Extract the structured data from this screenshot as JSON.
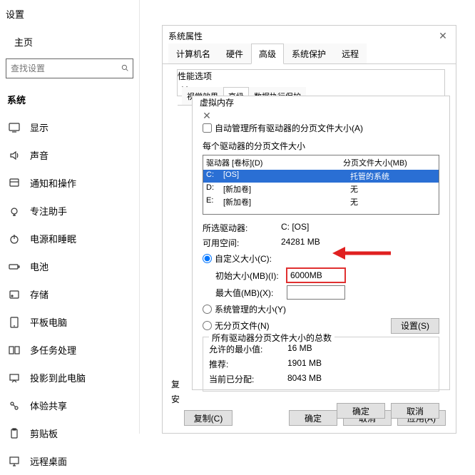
{
  "settings": {
    "title": "设置",
    "home": "主页",
    "search_placeholder": "查找设置",
    "category": "系统",
    "nav": [
      {
        "id": "display",
        "label": "显示"
      },
      {
        "id": "sound",
        "label": "声音"
      },
      {
        "id": "notifications",
        "label": "通知和操作"
      },
      {
        "id": "focus",
        "label": "专注助手"
      },
      {
        "id": "power",
        "label": "电源和睡眠"
      },
      {
        "id": "battery",
        "label": "电池"
      },
      {
        "id": "storage",
        "label": "存储"
      },
      {
        "id": "tablet",
        "label": "平板电脑"
      },
      {
        "id": "multitask",
        "label": "多任务处理"
      },
      {
        "id": "project",
        "label": "投影到此电脑"
      },
      {
        "id": "shared",
        "label": "体验共享"
      },
      {
        "id": "clipboard",
        "label": "剪贴板"
      },
      {
        "id": "remote",
        "label": "远程桌面"
      }
    ]
  },
  "sysprops": {
    "title": "系统属性",
    "tabs": [
      "计算机名",
      "硬件",
      "高级",
      "系统保护",
      "远程"
    ],
    "active_tab": 2,
    "hint1": "复",
    "hint2": "安",
    "copy_btn": "复制(C)",
    "ok": "确定",
    "cancel": "取消",
    "apply": "应用(A)"
  },
  "perfopts": {
    "title": "性能选项",
    "tabs": [
      "视觉效果",
      "高级",
      "数据执行保护"
    ],
    "active_tab": 1
  },
  "vmem": {
    "title": "虚拟内存",
    "auto_manage": "自动管理所有驱动器的分页文件大小(A)",
    "each_drive": "每个驱动器的分页文件大小",
    "col_drive": "驱动器 [卷标](D)",
    "col_pagefile": "分页文件大小(MB)",
    "drives": [
      {
        "letter": "C:",
        "label": "[OS]",
        "size": "托管的系统",
        "selected": true
      },
      {
        "letter": "D:",
        "label": "[新加卷]",
        "size": "无",
        "selected": false
      },
      {
        "letter": "E:",
        "label": "[新加卷]",
        "size": "无",
        "selected": false
      }
    ],
    "selected_drive_lbl": "所选驱动器:",
    "selected_drive_val": "C:  [OS]",
    "avail_space_lbl": "可用空间:",
    "avail_space_val": "24281 MB",
    "custom_size": "自定义大小(C):",
    "initial_size_lbl": "初始大小(MB)(I):",
    "initial_size_val": "6000MB",
    "max_size_lbl": "最大值(MB)(X):",
    "max_size_val": "",
    "system_managed": "系统管理的大小(Y)",
    "no_paging": "无分页文件(N)",
    "set_btn": "设置(S)",
    "totals_legend": "所有驱动器分页文件大小的总数",
    "min_lbl": "允许的最小值:",
    "min_val": "16 MB",
    "rec_lbl": "推荐:",
    "rec_val": "1901 MB",
    "cur_lbl": "当前已分配:",
    "cur_val": "8043 MB",
    "ok": "确定",
    "cancel": "取消"
  }
}
